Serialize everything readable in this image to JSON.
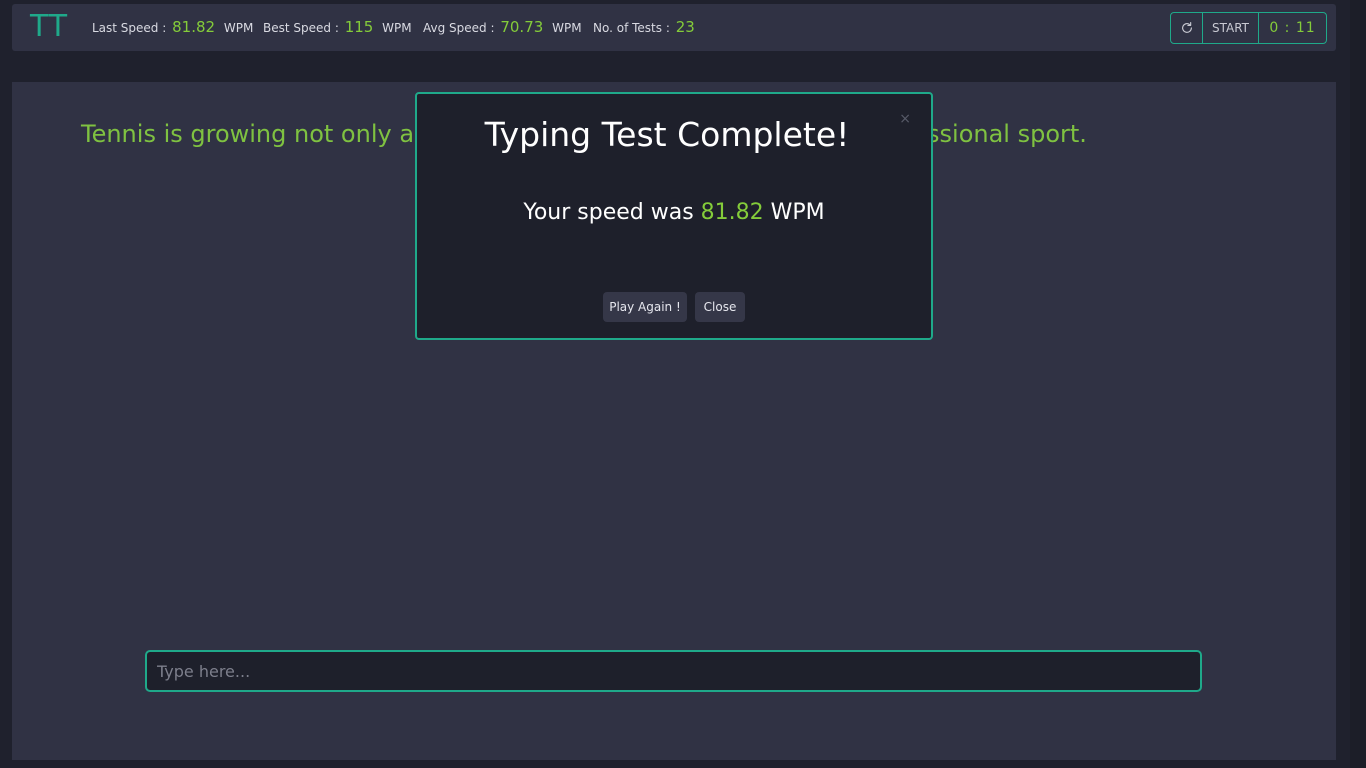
{
  "navbar": {
    "logo": "TT",
    "stats": {
      "last_speed": {
        "label": "Last Speed :",
        "value": "81.82",
        "unit": "WPM"
      },
      "best_speed": {
        "label": "Best Speed :",
        "value": "115",
        "unit": "WPM"
      },
      "avg_speed": {
        "label": "Avg Speed :",
        "value": "70.73",
        "unit": "WPM"
      },
      "num_tests": {
        "label": "No. of Tests :",
        "value": "23"
      }
    },
    "controls": {
      "reload_icon": "reload-icon",
      "start_label": "START",
      "timer": "0 : 11"
    }
  },
  "main": {
    "test_text": "Tennis is growing not only as a recreational activity but also as a professional sport.",
    "input": {
      "placeholder": "Type here...",
      "value": ""
    }
  },
  "modal": {
    "title": "Typing Test Complete!",
    "body_prefix": "Your speed was",
    "speed_value": "81.82",
    "speed_unit": "WPM",
    "close_x": "×",
    "play_again_label": "Play Again !",
    "close_label": "Close"
  },
  "colors": {
    "accent_teal": "#1fa98a",
    "accent_green": "#84cc3a",
    "panel": "#303244",
    "background": "#1f212d"
  }
}
